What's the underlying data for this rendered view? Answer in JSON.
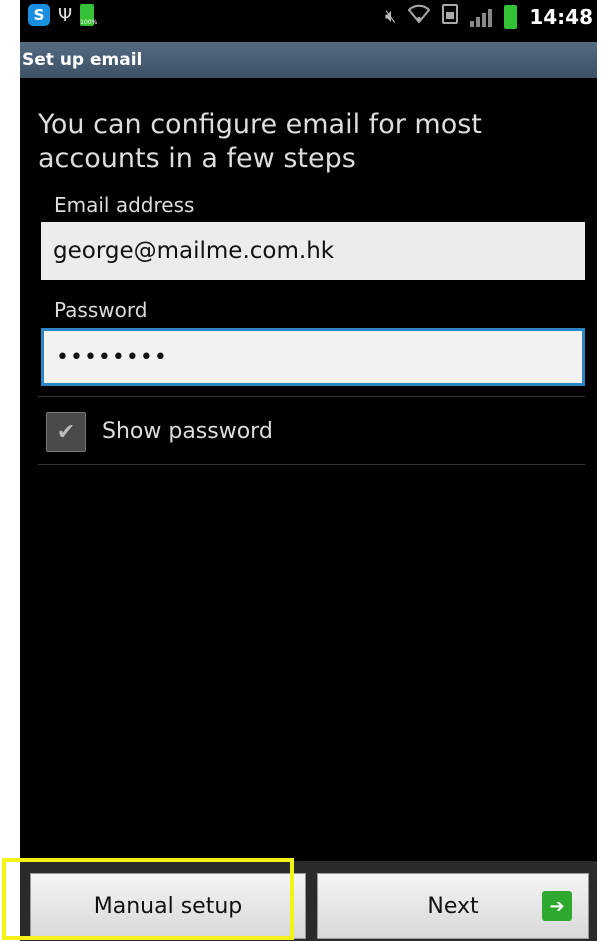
{
  "status_bar": {
    "time": "14:48",
    "battery_label": "100%",
    "icons": [
      "skype-icon",
      "usb-icon",
      "battery-icon",
      "mute-icon",
      "wifi-icon",
      "sim-icon",
      "signal-icon",
      "battery-icon"
    ]
  },
  "header": {
    "title": "Set up email"
  },
  "intro_text": "You can configure email for most accounts in a few steps",
  "form": {
    "email_label": "Email address",
    "email_value": "george@mailme.com.hk",
    "password_label": "Password",
    "password_value": "••••••••",
    "show_password_label": "Show password",
    "show_password_checked": true
  },
  "buttons": {
    "manual_setup": "Manual setup",
    "next": "Next"
  },
  "colors": {
    "header_bg": "#4a5e74",
    "focus_border": "#2a87c5",
    "highlight": "#f5f21a",
    "next_arrow": "#2ea82e"
  }
}
